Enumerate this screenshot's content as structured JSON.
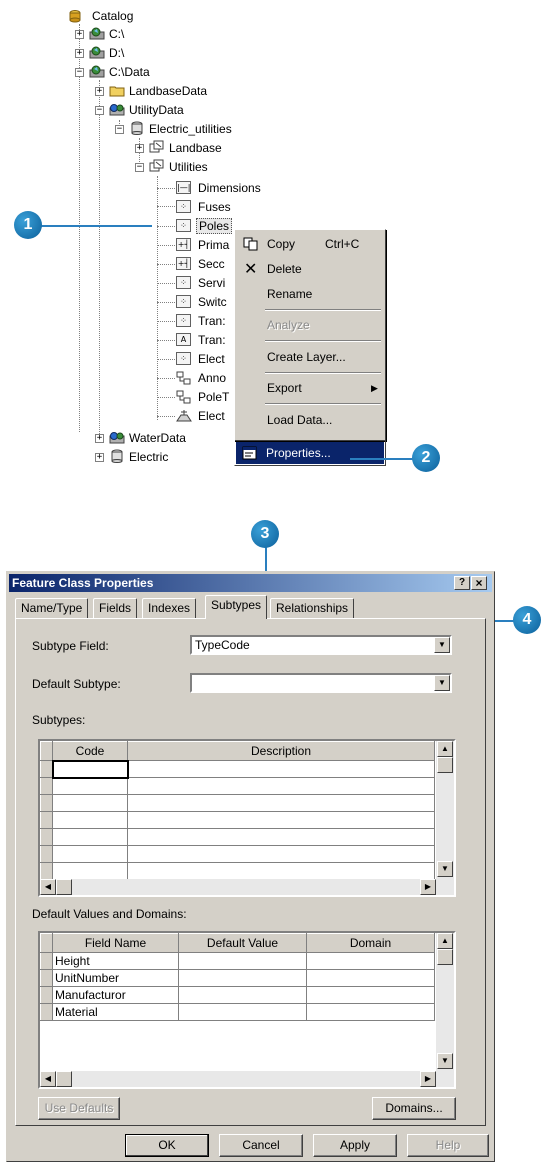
{
  "tree": {
    "root": "Catalog",
    "c_drive": "C:\\",
    "d_drive": "D:\\",
    "c_data": "C:\\Data",
    "landbase_data": "LandbaseData",
    "utility_data": "UtilityData",
    "electric_utilities": "Electric_utilities",
    "landbase": "Landbase",
    "utilities": "Utilities",
    "feature_classes": [
      {
        "label": "Dimensions",
        "icon": "dimension-icon"
      },
      {
        "label": "Fuses",
        "icon": "point-fc-icon"
      },
      {
        "label": "Poles",
        "icon": "point-fc-icon"
      },
      {
        "label": "Prima",
        "icon": "line-fc-icon"
      },
      {
        "label": "Secc",
        "icon": "line-fc-icon"
      },
      {
        "label": "Servi",
        "icon": "point-fc-icon"
      },
      {
        "label": "Switc",
        "icon": "point-fc-icon"
      },
      {
        "label": "Tran:",
        "icon": "point-fc-icon"
      },
      {
        "label": "Tran:",
        "icon": "annotation-icon"
      },
      {
        "label": "Elect",
        "icon": "point-fc-icon"
      },
      {
        "label": "Anno",
        "icon": "relationship-icon"
      },
      {
        "label": "PoleT",
        "icon": "relationship-icon"
      },
      {
        "label": "Elect",
        "icon": "network-icon"
      }
    ],
    "water_data": "WaterData",
    "electric": "Electric"
  },
  "context_menu": {
    "copy": "Copy",
    "copy_shortcut": "Ctrl+C",
    "delete": "Delete",
    "rename": "Rename",
    "analyze": "Analyze",
    "create_layer": "Create Layer...",
    "export": "Export",
    "load_data": "Load Data...",
    "properties": "Properties..."
  },
  "callouts": {
    "one": "1",
    "two": "2",
    "three": "3",
    "four": "4"
  },
  "dialog": {
    "title": "Feature Class Properties",
    "help_btn": "?",
    "close_btn": "×",
    "tabs": [
      "Name/Type",
      "Fields",
      "Indexes",
      "Subtypes",
      "Relationships"
    ],
    "active_tab": "Subtypes",
    "subtype_field_label": "Subtype Field:",
    "subtype_field_value": "TypeCode",
    "default_subtype_label": "Default Subtype:",
    "default_subtype_value": "",
    "subtypes_label": "Subtypes:",
    "subtypes_columns": [
      "Code",
      "Description"
    ],
    "defaults_label": "Default Values and Domains:",
    "defaults_columns": [
      "Field Name",
      "Default Value",
      "Domain"
    ],
    "defaults_rows": [
      "Height",
      "UnitNumber",
      "Manufacturor",
      "Material"
    ],
    "use_defaults": "Use Defaults",
    "domains": "Domains...",
    "ok": "OK",
    "cancel": "Cancel",
    "apply": "Apply",
    "help": "Help"
  },
  "colors": {
    "callout": "#1a7fc1",
    "highlight": "#0a246a",
    "dialog_bg": "#d4d0c8"
  }
}
